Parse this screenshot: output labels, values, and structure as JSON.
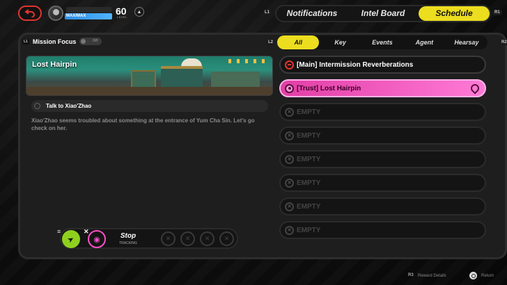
{
  "header": {
    "hp_label": "MAX/MAX",
    "level": "60",
    "level_label": "LEVEL",
    "l1": "L1",
    "r1": "R1",
    "tabs": [
      {
        "label": "Notifications",
        "active": false
      },
      {
        "label": "Intel Board",
        "active": false
      },
      {
        "label": "Schedule",
        "active": true
      }
    ]
  },
  "focus": {
    "badge": "L1",
    "label": "Mission Focus",
    "toggle": "Off"
  },
  "filters": {
    "l2": "L2",
    "r2": "R2",
    "tabs": [
      {
        "label": "All",
        "active": true
      },
      {
        "label": "Key",
        "active": false
      },
      {
        "label": "Events",
        "active": false
      },
      {
        "label": "Agent",
        "active": false
      },
      {
        "label": "Hearsay",
        "active": false
      }
    ]
  },
  "detail": {
    "title": "Lost Hairpin",
    "objective": "Talk to Xiao'Zhao",
    "description": "Xiao'Zhao seems troubled about something at the entrance of Yum Cha Sin. Let's go check on her."
  },
  "quests": [
    {
      "label": "[Main] Intermission Reverberations",
      "type": "main"
    },
    {
      "label": "[Trust] Lost Hairpin",
      "type": "trust"
    },
    {
      "label": "EMPTY",
      "type": "empty"
    },
    {
      "label": "EMPTY",
      "type": "empty"
    },
    {
      "label": "EMPTY",
      "type": "empty"
    },
    {
      "label": "EMPTY",
      "type": "empty"
    },
    {
      "label": "EMPTY",
      "type": "empty"
    },
    {
      "label": "EMPTY",
      "type": "empty"
    }
  ],
  "tracking": {
    "stop_label": "Stop",
    "tracking_label": "TRACKING"
  },
  "footer": {
    "r3": "R3",
    "reward_details": "Reward Details",
    "return": "Return"
  },
  "colors": {
    "accent": "#ecdd1f",
    "trust": "#ff7ad6",
    "main": "#e5342e"
  }
}
